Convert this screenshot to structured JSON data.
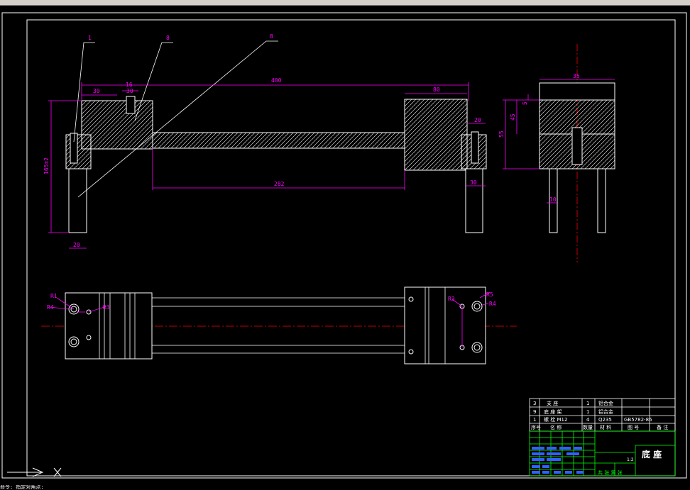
{
  "drawing": {
    "balloons": [
      "1",
      "8",
      "8"
    ],
    "dims_front": {
      "overall": "400",
      "left_pad": "30",
      "slot_width": "16",
      "slot_depth": "30",
      "right_block": "80",
      "height_total": "165±2",
      "foot_width": "20",
      "right_step": "20",
      "right_foot": "30",
      "rail_length": "282"
    },
    "dims_side": {
      "top": "35",
      "small": "5",
      "mid": "45",
      "height": "55",
      "leg": "10"
    },
    "dims_plan": {
      "left_r1": "R1",
      "left_r4": "R4",
      "left_r3": "R3",
      "right_r3": "R3",
      "right_r5": "R5",
      "right_r4": "R4"
    }
  },
  "title_block": {
    "parts": [
      {
        "no": "3",
        "name": "支 座",
        "qty": "1",
        "material": "铝合金",
        "code": ""
      },
      {
        "no": "9",
        "name": "底 座 架",
        "qty": "1",
        "material": "铝合金",
        "code": ""
      },
      {
        "no": "1",
        "name": "螺 栓 M12",
        "qty": "4",
        "material": "Q235",
        "code": "GB5782-86"
      }
    ],
    "header": [
      "序号",
      "名 称",
      "数量",
      "材 料",
      "图 号",
      "备 注"
    ],
    "title": "底 座",
    "scale": "1:2",
    "footer": "共 张  第 张"
  },
  "colors": {
    "background": "#000000",
    "line": "#ffffff",
    "dimension": "#ff00ff",
    "centerline": "#ff0000",
    "title_grid": "#00ff00",
    "label_blocks": "#3060ff"
  },
  "command_line": "命令: 指定对角点:"
}
